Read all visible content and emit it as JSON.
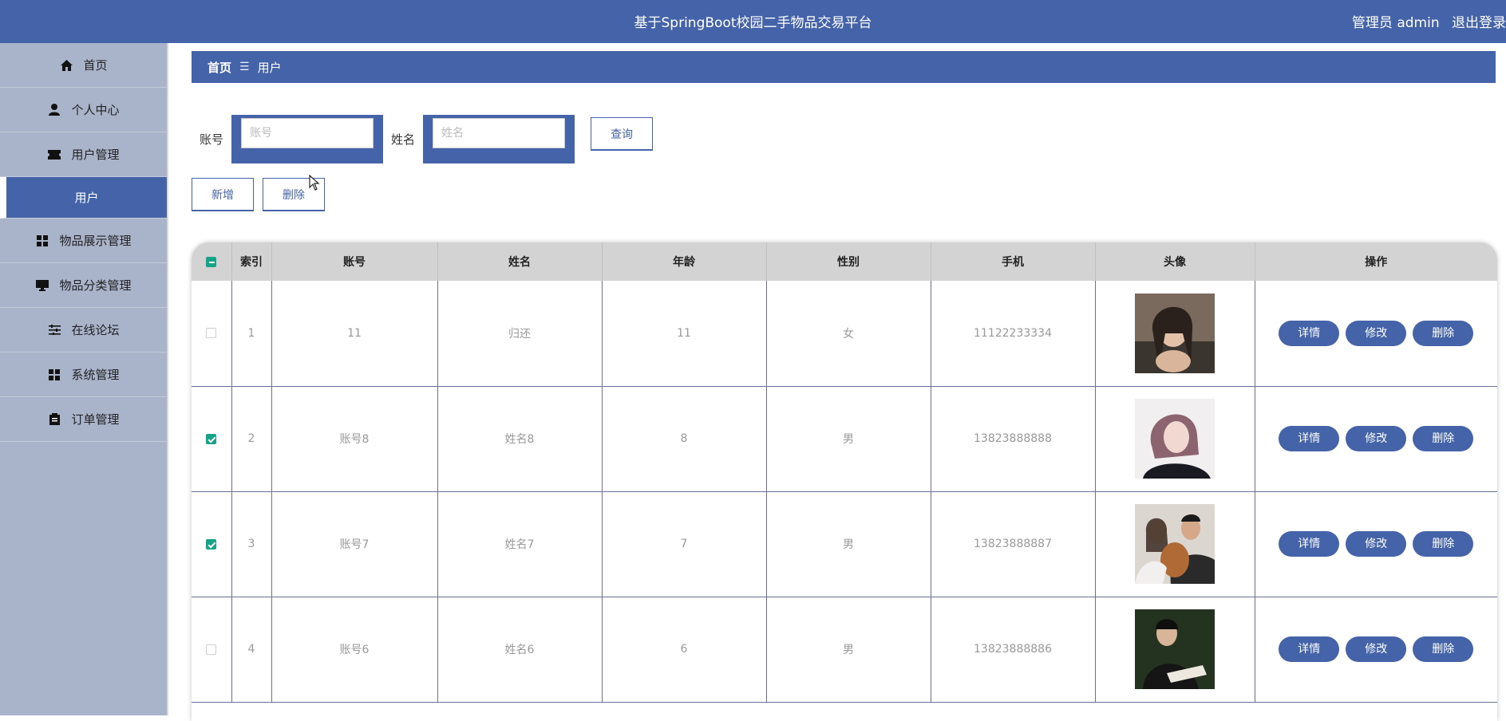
{
  "header": {
    "title": "基于SpringBoot校园二手物品交易平台",
    "role": "管理员 admin",
    "logout": "退出登录"
  },
  "sidebar": {
    "items": [
      {
        "label": "首页",
        "icon": "home-icon"
      },
      {
        "label": "个人中心",
        "icon": "person-icon"
      },
      {
        "label": "用户管理",
        "icon": "ticket-icon"
      },
      {
        "label": "用户",
        "icon": ""
      },
      {
        "label": "物品展示管理",
        "icon": "grid-icon"
      },
      {
        "label": "物品分类管理",
        "icon": "monitor-icon"
      },
      {
        "label": "在线论坛",
        "icon": "sliders-icon"
      },
      {
        "label": "系统管理",
        "icon": "grid-icon"
      },
      {
        "label": "订单管理",
        "icon": "clipboard-icon"
      }
    ]
  },
  "breadcrumb": {
    "home": "首页",
    "sep": "☰",
    "current": "用户"
  },
  "search": {
    "account_label": "账号",
    "account_placeholder": "账号",
    "name_label": "姓名",
    "name_placeholder": "姓名",
    "query_button": "查询"
  },
  "actions": {
    "add": "新增",
    "delete": "删除"
  },
  "table": {
    "headers": [
      "索引",
      "账号",
      "姓名",
      "年龄",
      "性别",
      "手机",
      "头像",
      "操作"
    ],
    "rows": [
      {
        "index": "1",
        "account": "11",
        "name": "归还",
        "age": "11",
        "gender": "女",
        "phone": "11122233334",
        "checked": false
      },
      {
        "index": "2",
        "account": "账号8",
        "name": "姓名8",
        "age": "8",
        "gender": "男",
        "phone": "13823888888",
        "checked": true
      },
      {
        "index": "3",
        "account": "账号7",
        "name": "姓名7",
        "age": "7",
        "gender": "男",
        "phone": "13823888887",
        "checked": true
      },
      {
        "index": "4",
        "account": "账号6",
        "name": "姓名6",
        "age": "6",
        "gender": "男",
        "phone": "13823888886",
        "checked": false
      }
    ],
    "ops": {
      "detail": "详情",
      "edit": "修改",
      "delete": "删除"
    }
  },
  "colors": {
    "primary": "#4463a8",
    "sidebar": "#a9b4cb",
    "check": "#16a387"
  }
}
